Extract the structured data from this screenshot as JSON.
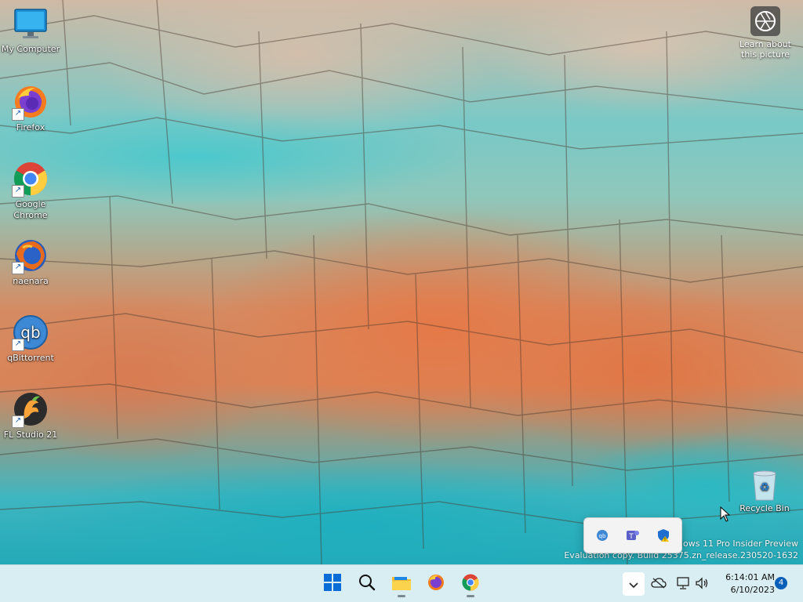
{
  "desktop": {
    "icons": [
      {
        "label": "My Computer",
        "icon": "monitor-icon"
      },
      {
        "label": "Firefox",
        "icon": "firefox-icon"
      },
      {
        "label": "Google Chrome",
        "icon": "chrome-icon"
      },
      {
        "label": "naenara",
        "icon": "firefox-icon"
      },
      {
        "label": "qBittorrent",
        "icon": "qbittorrent-icon"
      },
      {
        "label": "FL Studio 21",
        "icon": "fl-studio-icon"
      }
    ],
    "recycle_bin": {
      "label": "Recycle Bin",
      "icon": "recycle-bin-icon"
    },
    "learn_about": {
      "line1": "Learn about",
      "line2": "this picture",
      "icon": "camera-lens-icon"
    },
    "watermark": {
      "line1": "dows 11 Pro Insider Preview",
      "line2": "Evaluation copy. Build 25375.zn_release.230520-1632"
    }
  },
  "tray_flyout": {
    "icons": [
      "qbittorrent-tray-icon",
      "teams-tray-icon",
      "defender-warning-icon"
    ]
  },
  "taskbar": {
    "pinned": [
      "windows-start-icon",
      "search-icon",
      "file-explorer-icon",
      "firefox-icon",
      "chrome-icon"
    ],
    "clock": {
      "time": "6:14:01 AM",
      "date": "6/10/2023"
    },
    "notification_count": "4",
    "system_icons": [
      "onedrive-offline-icon",
      "network-icon",
      "volume-icon"
    ]
  },
  "colors": {
    "taskbar_bg": "#d9eef3",
    "accent": "#0a5fb8"
  }
}
